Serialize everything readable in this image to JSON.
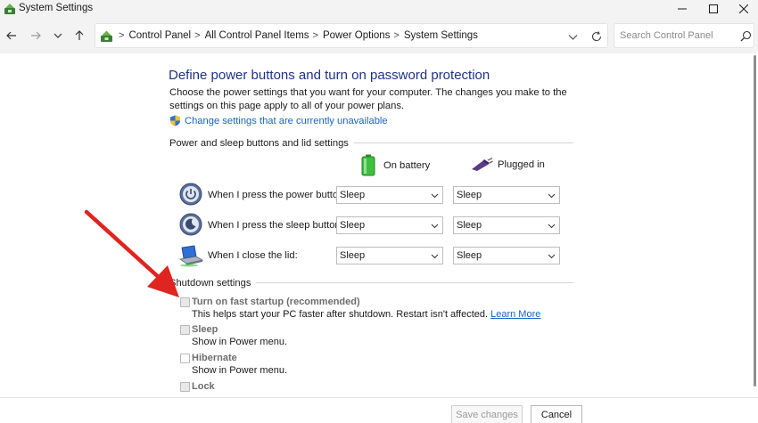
{
  "window": {
    "title": "System Settings",
    "controls": {
      "minimize": "minimize-icon",
      "maximize": "maximize-icon",
      "close": "close-icon"
    }
  },
  "nav": {
    "breadcrumbs": [
      "Control Panel",
      "All Control Panel Items",
      "Power Options",
      "System Settings"
    ],
    "search_placeholder": "Search Control Panel",
    "icons": [
      "back-arrow-icon",
      "forward-arrow-icon",
      "chevron-down-icon",
      "up-arrow-icon",
      "refresh-icon",
      "search-icon"
    ]
  },
  "main": {
    "heading": "Define power buttons and turn on password protection",
    "description": "Choose the power settings that you want for your computer. The changes you make to the settings on this page apply to all of your power plans.",
    "change_link": "Change settings that are currently unavailable",
    "power_section": {
      "title": "Power and sleep buttons and lid settings",
      "columns": [
        "On battery",
        "Plugged in"
      ],
      "rows": [
        {
          "label": "When I press the power button:",
          "on_battery": "Sleep",
          "plugged_in": "Sleep"
        },
        {
          "label": "When I press the sleep button:",
          "on_battery": "Sleep",
          "plugged_in": "Sleep"
        },
        {
          "label": "When I close the lid:",
          "on_battery": "Sleep",
          "plugged_in": "Sleep"
        }
      ]
    },
    "shutdown_section": {
      "title": "Shutdown settings",
      "options": [
        {
          "label": "Turn on fast startup (recommended)",
          "description": "This helps start your PC faster after shutdown. Restart isn't affected.",
          "link": "Learn More",
          "checked": false
        },
        {
          "label": "Sleep",
          "description": "Show in Power menu.",
          "checked": false
        },
        {
          "label": "Hibernate",
          "description": "Show in Power menu.",
          "checked": false
        },
        {
          "label": "Lock",
          "description": "",
          "checked": false
        }
      ]
    }
  },
  "footer": {
    "save_label": "Save changes",
    "cancel_label": "Cancel"
  },
  "colors": {
    "heading": "#1e3287",
    "link": "#1a64c8",
    "annotation_arrow": "#e0241f"
  }
}
